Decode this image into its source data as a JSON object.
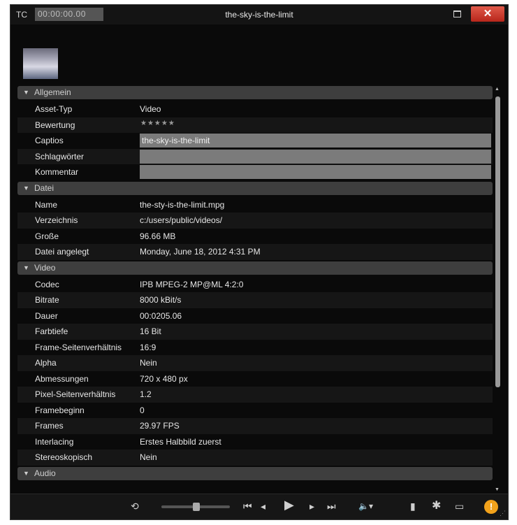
{
  "window": {
    "tc_label": "TC",
    "timecode": "00:00:00.00",
    "title": "the-sky-is-the-limit",
    "close_label": "✕"
  },
  "sections": {
    "general": {
      "title": "Allgemein",
      "asset_type": {
        "label": "Asset-Typ",
        "value": "Video"
      },
      "rating": {
        "label": "Bewertung",
        "value": "★★★★★"
      },
      "caption": {
        "label": "Captios",
        "value": "the-sky-is-the-limit"
      },
      "keywords": {
        "label": "Schlagwörter",
        "value": ""
      },
      "comment": {
        "label": "Kommentar",
        "value": ""
      }
    },
    "file": {
      "title": "Datei",
      "name": {
        "label": "Name",
        "value": "the-sty-is-the-limit.mpg"
      },
      "directory": {
        "label": "Verzeichnis",
        "value": "c:/users/public/videos/"
      },
      "size": {
        "label": "Große",
        "value": "96.66 MB"
      },
      "created": {
        "label": "Datei angelegt",
        "value": "Monday, June 18, 2012 4:31 PM"
      }
    },
    "video": {
      "title": "Video",
      "codec": {
        "label": "Codec",
        "value": "IPB MPEG-2 MP@ML 4:2:0"
      },
      "bitrate": {
        "label": "Bitrate",
        "value": "8000 kBit/s"
      },
      "duration": {
        "label": "Dauer",
        "value": "00:0205.06"
      },
      "depth": {
        "label": "Farbtiefe",
        "value": "16 Bit"
      },
      "aspect": {
        "label": "Frame-Seitenverhältnis",
        "value": "16:9"
      },
      "alpha": {
        "label": "Alpha",
        "value": "Nein"
      },
      "dimensions": {
        "label": "Abmessungen",
        "value": "720 x 480 px"
      },
      "pixel_aspect": {
        "label": "Pixel-Seitenverhältnis",
        "value": "1.2"
      },
      "frame_start": {
        "label": "Framebeginn",
        "value": "0"
      },
      "frames": {
        "label": "Frames",
        "value": "29.97 FPS"
      },
      "interlacing": {
        "label": "Interlacing",
        "value": "Erstes Halbbild zuerst"
      },
      "stereo": {
        "label": "Stereoskopisch",
        "value": "Nein"
      }
    },
    "audio": {
      "title": "Audio"
    }
  },
  "toolbar": {
    "loop_icon": "⟲",
    "first_icon": "⏮",
    "prev_frame_icon": "◂",
    "play_icon": "▶",
    "next_frame_icon": "▸",
    "last_icon": "⏭",
    "volume_icon": "🔈▾",
    "copy_icon": "▮",
    "settings_icon": "✱",
    "window_icon": "▭",
    "warning_icon": "!"
  }
}
